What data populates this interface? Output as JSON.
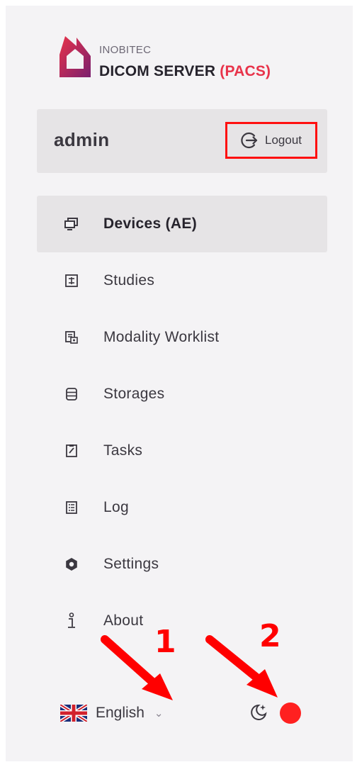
{
  "brand": {
    "company": "INOBITEC",
    "product_main": "DICOM SERVER",
    "product_accent": "(PACS)"
  },
  "user": {
    "name": "admin",
    "logout_label": "Logout"
  },
  "nav": {
    "items": [
      {
        "label": "Devices (AE)",
        "icon": "monitor-icon",
        "active": true
      },
      {
        "label": "Studies",
        "icon": "studies-icon"
      },
      {
        "label": "Modality Worklist",
        "icon": "worklist-icon"
      },
      {
        "label": "Storages",
        "icon": "database-icon"
      },
      {
        "label": "Tasks",
        "icon": "tasks-icon"
      },
      {
        "label": "Log",
        "icon": "log-icon"
      },
      {
        "label": "Settings",
        "icon": "gear-icon"
      },
      {
        "label": "About",
        "icon": "info-icon"
      }
    ]
  },
  "footer": {
    "language": "English",
    "language_flag": "uk-flag-icon",
    "theme_icon": "moon-stars-icon"
  },
  "annotations": {
    "marker_1": "1",
    "marker_2": "2"
  },
  "colors": {
    "accent": "#e8334a",
    "annotation": "#ff0000",
    "sidebar_bg": "#f4f3f5",
    "active_bg": "#e6e4e6"
  }
}
